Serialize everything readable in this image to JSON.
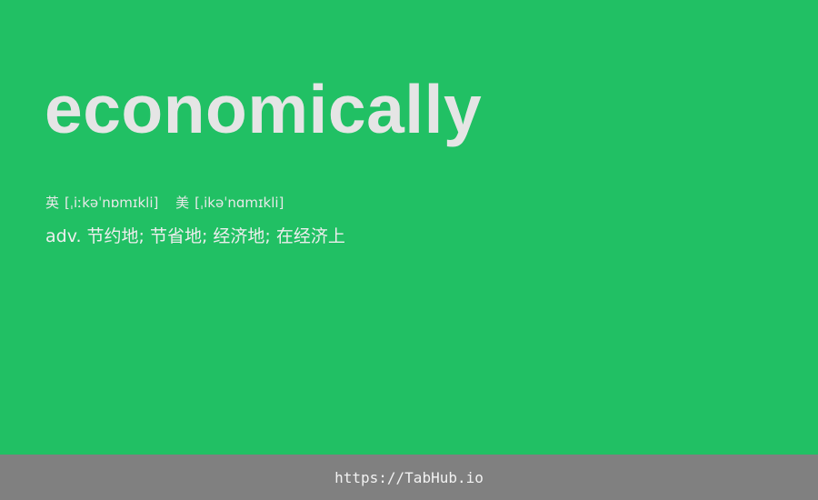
{
  "card": {
    "word": "economically",
    "phonetics": {
      "uk_label": "英",
      "uk": "[ˌiːkəˈnɒmɪkli]",
      "us_label": "美",
      "us": "[ˌikəˈnɑmɪkli]"
    },
    "definition": "adv. 节约地; 节省地; 经济地; 在经济上"
  },
  "footer": {
    "link_text": "https://TabHub.io"
  },
  "colors": {
    "background": "#21c064",
    "footer_background": "#808080",
    "text": "#e5e5e5"
  }
}
